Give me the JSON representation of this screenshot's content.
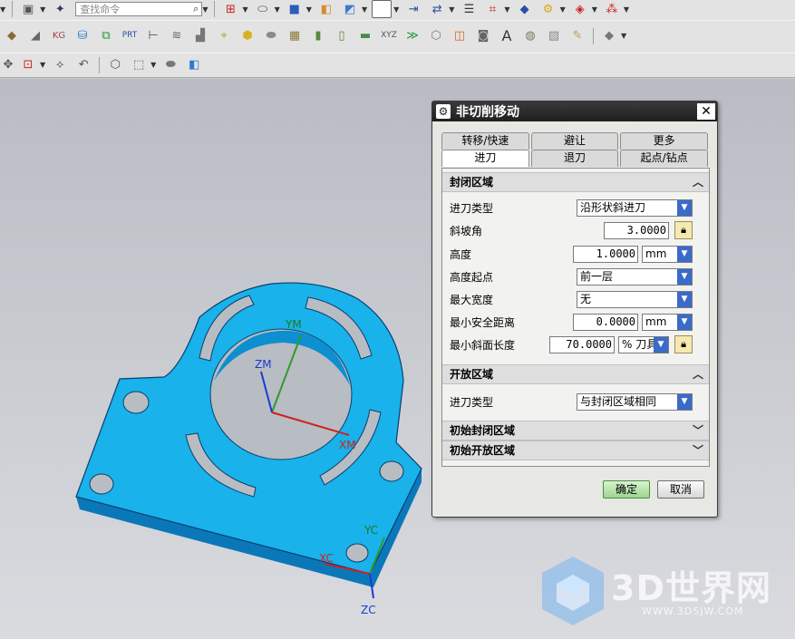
{
  "toolbar": {
    "search_placeholder": "查找命令"
  },
  "viewport": {
    "axes": {
      "ym": "YM",
      "zm": "ZM",
      "xm": "XM",
      "yc": "YC",
      "xc": "XC",
      "zc": "ZC"
    },
    "part_color": "#17b2ec"
  },
  "dialog": {
    "title": "非切削移动",
    "tabs_row1": [
      "转移/快速",
      "避让",
      "更多"
    ],
    "tabs_row2": [
      "进刀",
      "退刀",
      "起点/钻点"
    ],
    "active_tab": "进刀",
    "closed_area": {
      "header": "封闭区域",
      "fields": [
        {
          "label": "进刀类型",
          "kind": "select",
          "value": "沿形状斜进刀"
        },
        {
          "label": "斜坡角",
          "kind": "input-lock",
          "value": "3.0000"
        },
        {
          "label": "高度",
          "kind": "input-unit",
          "value": "1.0000",
          "unit": "mm"
        },
        {
          "label": "高度起点",
          "kind": "select",
          "value": "前一层"
        },
        {
          "label": "最大宽度",
          "kind": "select",
          "value": "无"
        },
        {
          "label": "最小安全距离",
          "kind": "input-unit",
          "value": "0.0000",
          "unit": "mm"
        },
        {
          "label": "最小斜面长度",
          "kind": "input-unit-lock",
          "value": "70.0000",
          "unit": "% 刀具"
        }
      ]
    },
    "open_area": {
      "header": "开放区域",
      "fields": [
        {
          "label": "进刀类型",
          "kind": "select",
          "value": "与封闭区域相同"
        }
      ]
    },
    "initial_closed": {
      "header": "初始封闭区域"
    },
    "initial_open": {
      "header": "初始开放区域"
    },
    "ok_label": "确定",
    "cancel_label": "取消"
  },
  "watermark": {
    "brand": "3D世界网",
    "url": "WWW.3DSJW.COM"
  }
}
